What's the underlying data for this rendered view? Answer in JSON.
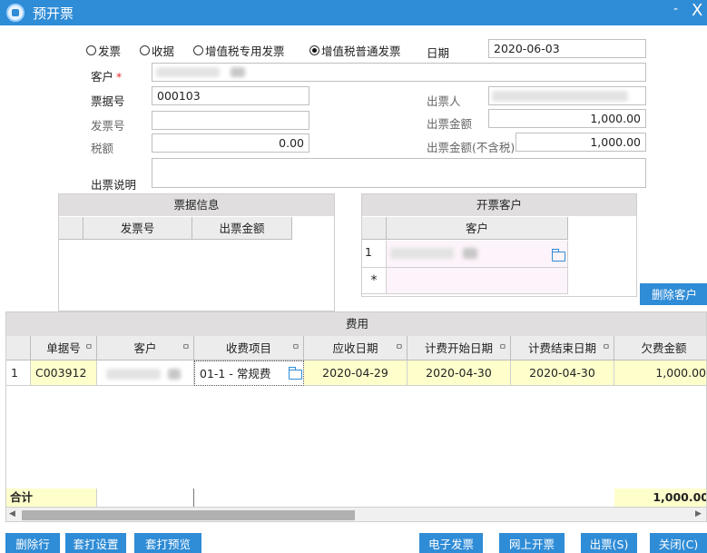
{
  "window": {
    "title": "预开票",
    "minimize_glyph": "-",
    "close_glyph": "X"
  },
  "doc_types": [
    {
      "label": "发票",
      "selected": false
    },
    {
      "label": "收据",
      "selected": false
    },
    {
      "label": "增值税专用发票",
      "selected": false
    },
    {
      "label": "增值税普通发票",
      "selected": true
    }
  ],
  "form": {
    "date_label": "日期",
    "date_value": "2020-06-03",
    "customer_label": "客户",
    "required_mark": "*",
    "receipt_no_label": "票据号",
    "receipt_no_value": "000103",
    "issuer_label": "出票人",
    "invoice_no_label": "发票号",
    "invoice_no_value": "",
    "issue_amount_label": "出票金额",
    "issue_amount_value": "1,000.00",
    "tax_label": "税额",
    "tax_value": "0.00",
    "amount_ex_tax_label": "出票金额(不含税)",
    "amount_ex_tax_value": "1,000.00",
    "note_label": "出票说明",
    "note_value": ""
  },
  "receipt_panel": {
    "title": "票据信息",
    "columns": [
      "发票号",
      "出票金额"
    ]
  },
  "customer_panel": {
    "title": "开票客户",
    "column": "客户",
    "row_number": "1",
    "new_row_glyph": "*",
    "delete_button": "删除客户"
  },
  "fee": {
    "title": "费用",
    "columns": [
      "单据号",
      "客户",
      "收费项目",
      "应收日期",
      "计费开始日期",
      "计费结束日期",
      "欠费金额"
    ],
    "pin_glyph": "ㅁ",
    "row": {
      "num": "1",
      "doc_no": "C003912",
      "item": "01-1 - 常规费",
      "due": "2020-04-29",
      "start": "2020-04-30",
      "end": "2020-04-30",
      "amount": "1,000.00"
    },
    "total_label": "合计",
    "total_amount": "1,000.00"
  },
  "scrollbar": {
    "left_arrow": "◀",
    "right_arrow": "▶"
  },
  "buttons": {
    "delete_row": "删除行",
    "print_setup": "套打设置",
    "print_preview": "套打预览",
    "e_invoice": "电子发票",
    "online_invoice": "网上开票",
    "issue": "出票(S)",
    "close": "关闭(C)"
  }
}
